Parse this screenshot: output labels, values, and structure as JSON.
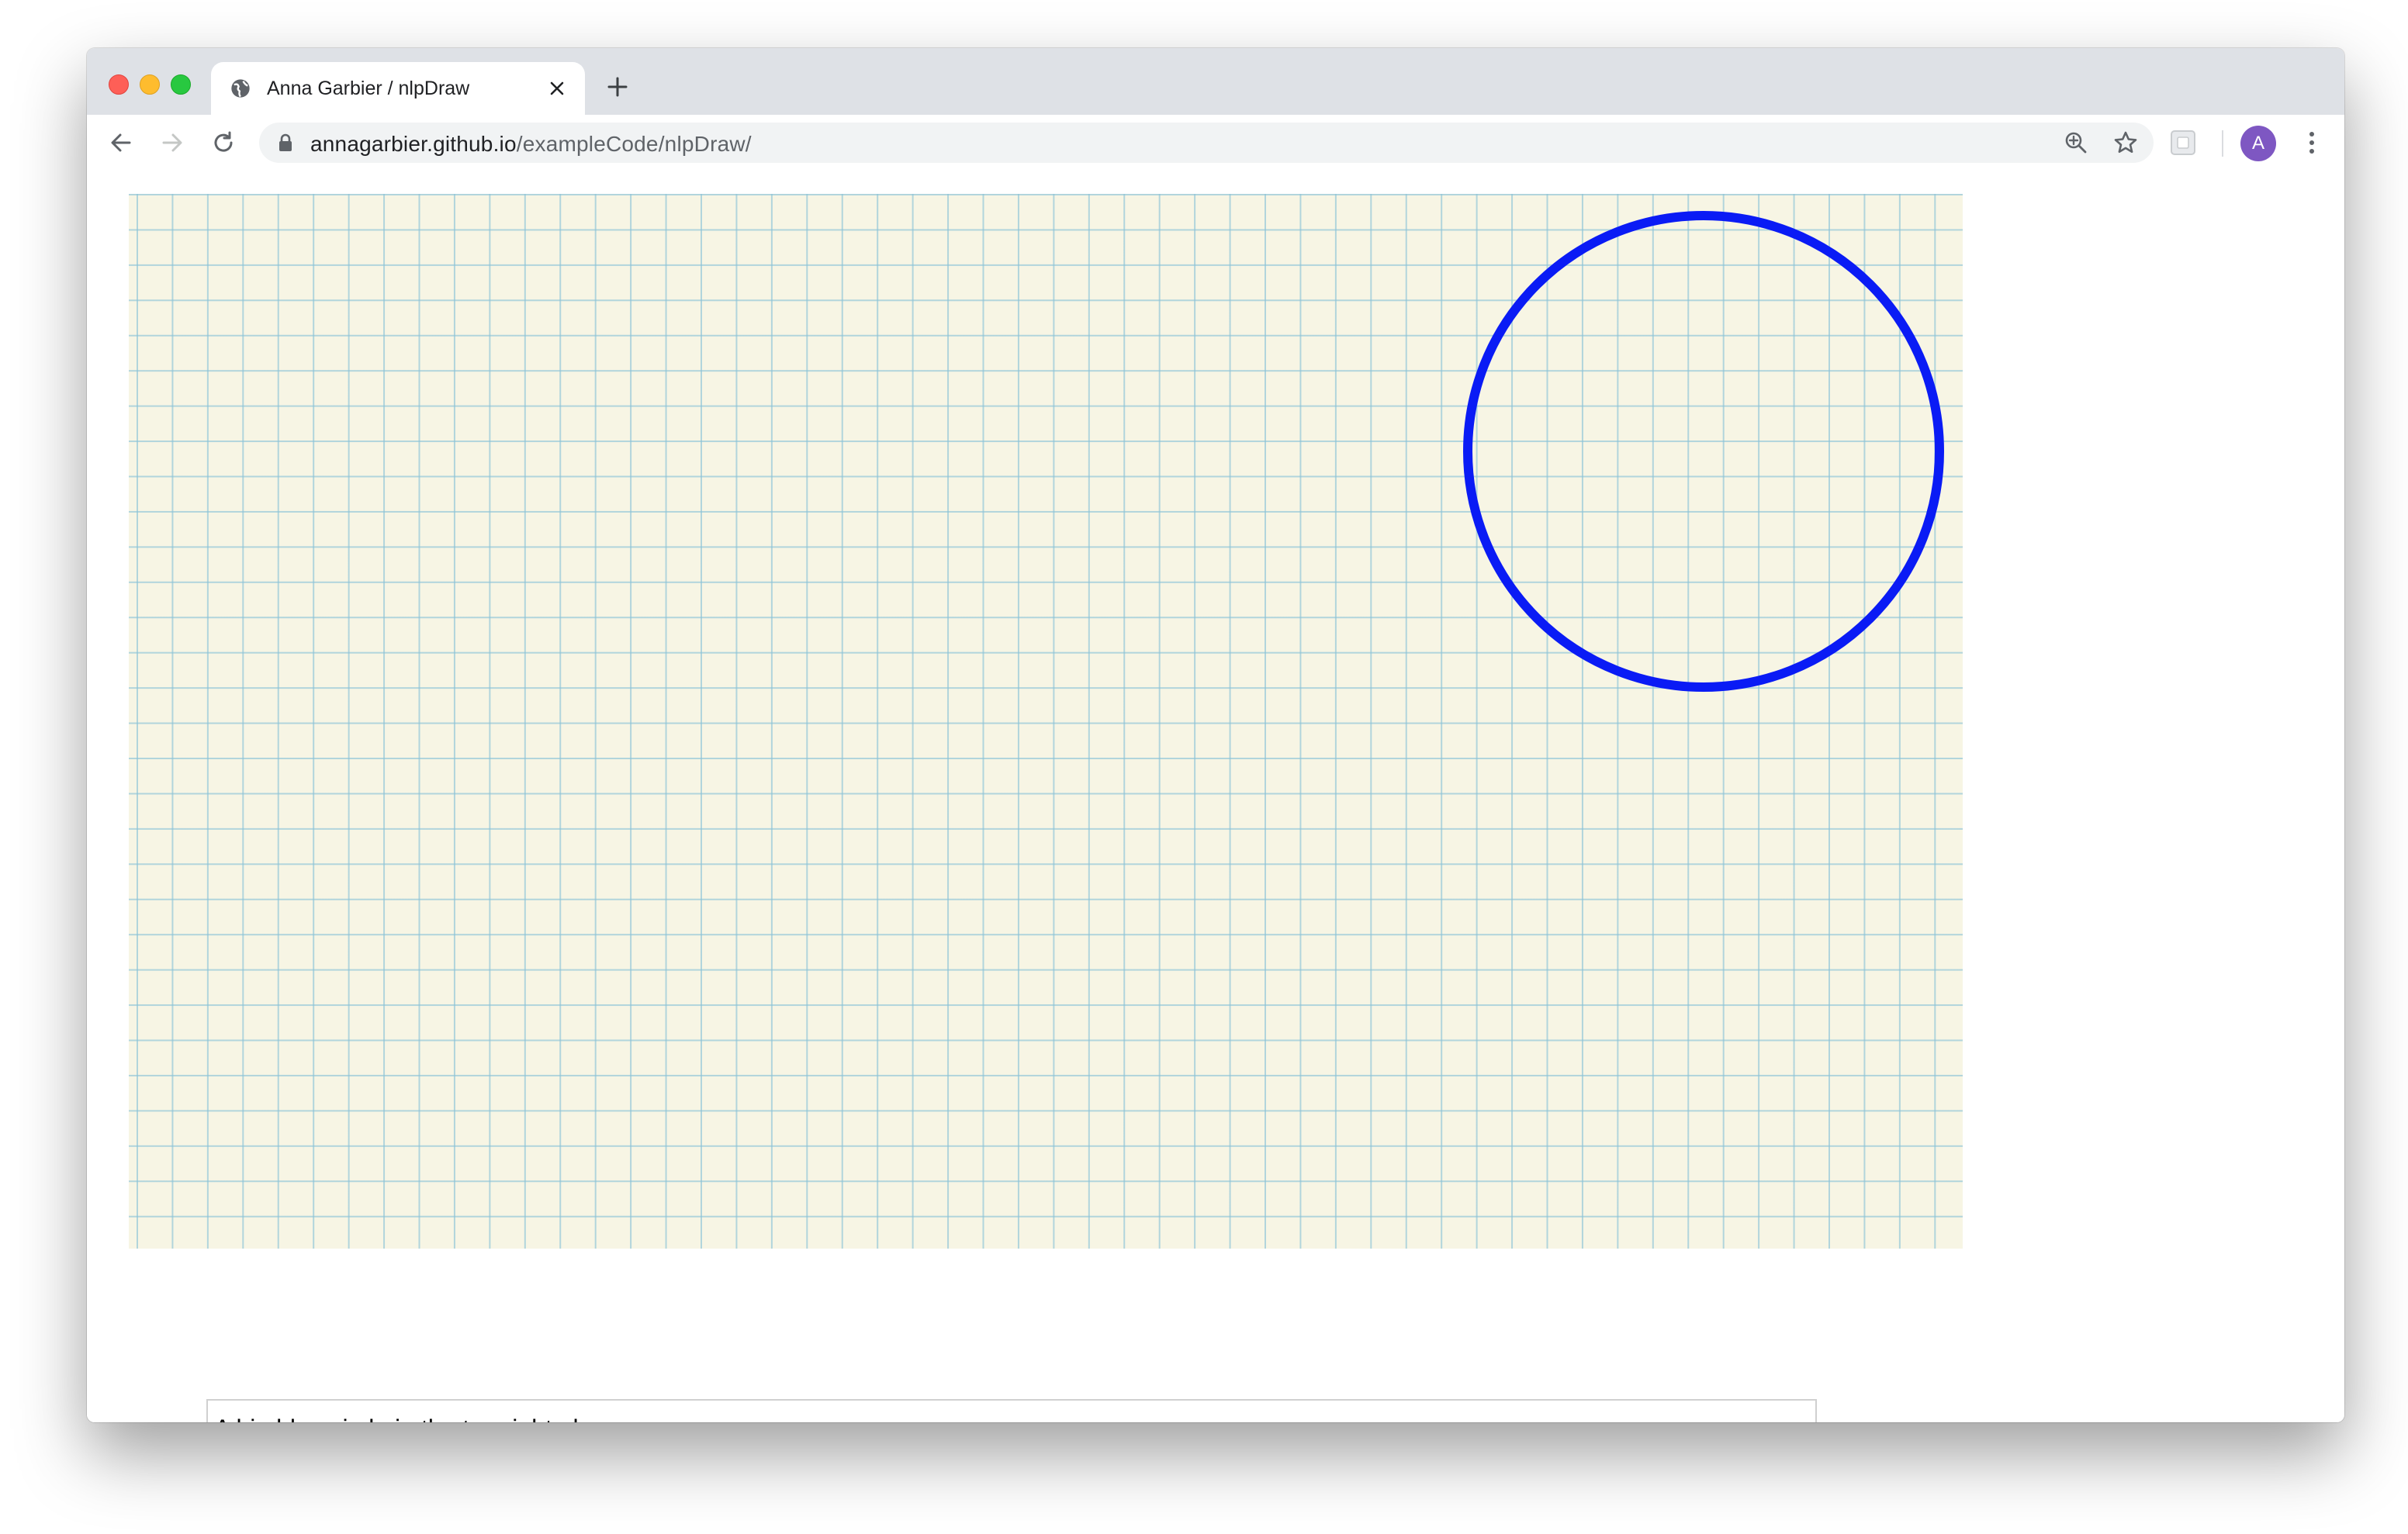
{
  "browser": {
    "tab": {
      "title": "Anna Garbier / nlpDraw",
      "favicon": "globe-icon"
    },
    "url": {
      "host": "annagarbier.github.io",
      "path": "/exampleCode/nlpDraw/"
    },
    "profile": {
      "initial": "A",
      "color": "#7e57c2"
    }
  },
  "page": {
    "canvas": {
      "background_color": "#f7f5e4",
      "grid_color": "#8cc3d7",
      "shapes": [
        {
          "type": "circle",
          "size": "big",
          "color": "#0a1bf5",
          "position": "top right",
          "fill": "none"
        }
      ]
    },
    "prompt_input": {
      "value": "A big blue circle in the top right please"
    }
  }
}
